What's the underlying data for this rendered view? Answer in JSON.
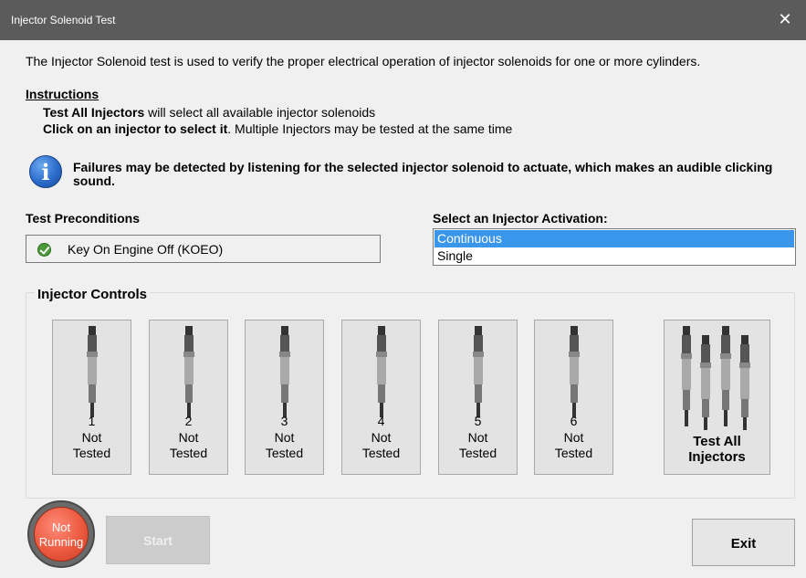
{
  "window": {
    "title": "Injector Solenoid Test",
    "close_glyph": "✕"
  },
  "intro": "The Injector Solenoid test is used to verify the proper electrical operation of injector solenoids for one or more cylinders.",
  "instructions": {
    "heading": "Instructions",
    "line1_bold": "Test All Injectors",
    "line1_rest": " will select all available injector solenoids",
    "line2_bold": "Click on an injector to select it",
    "line2_rest": ". Multiple Injectors may be tested at the same time"
  },
  "info": {
    "icon": "info-icon",
    "glyph": "i",
    "text": "Failures may be detected by listening for the selected injector solenoid to actuate, which makes an audible clicking sound."
  },
  "preconditions": {
    "label": "Test Preconditions",
    "item_icon": "check-icon",
    "item_text": "Key On Engine Off (KOEO)"
  },
  "activation": {
    "label": "Select an Injector Activation:",
    "options": [
      "Continuous",
      "Single"
    ],
    "selected": "Continuous"
  },
  "injector_controls": {
    "label": "Injector Controls",
    "injectors": [
      {
        "number": "1",
        "status_line1": "Not",
        "status_line2": "Tested"
      },
      {
        "number": "2",
        "status_line1": "Not",
        "status_line2": "Tested"
      },
      {
        "number": "3",
        "status_line1": "Not",
        "status_line2": "Tested"
      },
      {
        "number": "4",
        "status_line1": "Not",
        "status_line2": "Tested"
      },
      {
        "number": "5",
        "status_line1": "Not",
        "status_line2": "Tested"
      },
      {
        "number": "6",
        "status_line1": "Not",
        "status_line2": "Tested"
      }
    ],
    "test_all_line1": "Test All",
    "test_all_line2": "Injectors"
  },
  "status": {
    "line1": "Not",
    "line2": "Running",
    "color": "#ec5a3f"
  },
  "buttons": {
    "start": "Start",
    "exit": "Exit"
  },
  "colors": {
    "titlebar": "#5b5b5b",
    "selection": "#3a96ea"
  }
}
